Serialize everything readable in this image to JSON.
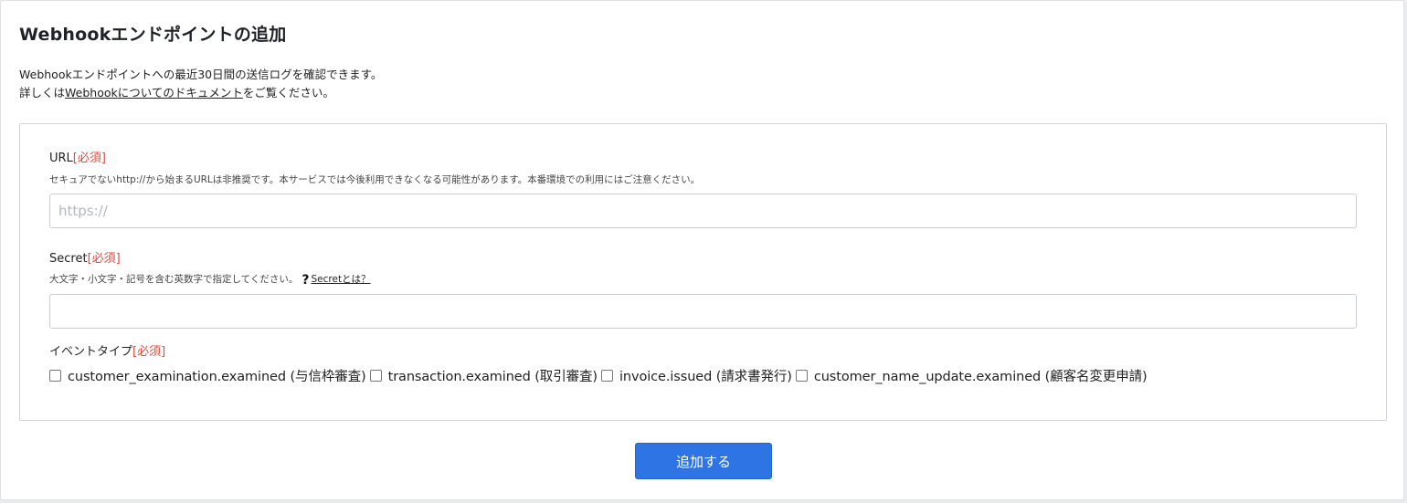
{
  "page": {
    "title": "Webhookエンドポイントの追加",
    "intro_line1": "Webhookエンドポイントへの最近30日間の送信ログを確認できます。",
    "intro_line2_prefix": "詳しくは",
    "intro_link": "Webhookについてのドキュメント",
    "intro_line2_suffix": "をご覧ください。"
  },
  "form": {
    "url": {
      "label": "URL",
      "required": "[必須]",
      "hint": "セキュアでないhttp://から始まるURLは非推奨です。本サービスでは今後利用できなくなる可能性があります。本番環境での利用にはご注意ください。",
      "value": "",
      "placeholder": "https://"
    },
    "secret": {
      "label": "Secret",
      "required": "[必須]",
      "hint": "大文字・小文字・記号を含む英数字で指定してください。",
      "help_icon": "question-icon",
      "help_link": "Secretとは？",
      "value": "",
      "placeholder": ""
    },
    "event_type": {
      "label": "イベントタイプ",
      "required": "[必須]",
      "options": [
        {
          "label": "customer_examination.examined (与信枠審査)",
          "checked": false
        },
        {
          "label": "transaction.examined (取引審査)",
          "checked": false
        },
        {
          "label": "invoice.issued (請求書発行)",
          "checked": false
        },
        {
          "label": "customer_name_update.examined (顧客名変更申請)",
          "checked": false
        }
      ]
    },
    "submit_label": "追加する"
  },
  "colors": {
    "accent": "#2f74e4",
    "required": "#e0493d"
  }
}
